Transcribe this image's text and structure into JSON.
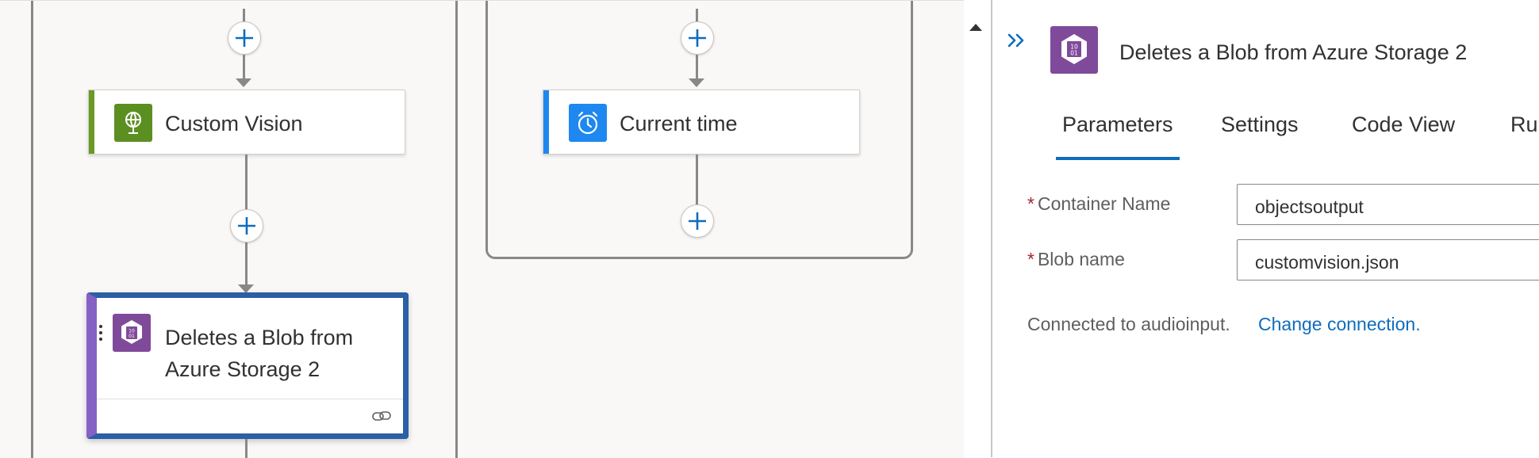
{
  "canvas": {
    "actions": {
      "custom_vision": {
        "title": "Custom Vision",
        "accent_color": "#6a9a24",
        "icon": "globe-icon",
        "icon_bg": "#5c8f22"
      },
      "current_time": {
        "title": "Current time",
        "accent_color": "#1e88f0",
        "icon": "alarm-clock-icon",
        "icon_bg": "#1e88f0"
      },
      "delete_blob": {
        "title": "Deletes a Blob from Azure Storage 2",
        "accent_color": "#8661c5",
        "icon": "blob-storage-icon",
        "icon_bg": "#804a9b",
        "footer_icon": "link-icon"
      }
    }
  },
  "panel": {
    "collapse_icon": "double-chevron-right-icon",
    "icon": "blob-storage-icon",
    "title": "Deletes a Blob from Azure Storage 2",
    "tabs": [
      {
        "label": "Parameters",
        "active": true
      },
      {
        "label": "Settings",
        "active": false
      },
      {
        "label": "Code View",
        "active": false
      },
      {
        "label": "Run",
        "active": false
      }
    ],
    "fields": [
      {
        "label": "Container Name",
        "required_marker": "*",
        "value": "objectsoutput"
      },
      {
        "label": "Blob name",
        "required_marker": "*",
        "value": "customvision.json"
      }
    ],
    "connection_text": "Connected to audioinput.",
    "change_connection_label": "Change connection."
  },
  "colors": {
    "accent": "#0f6cbd",
    "required": "#a4262c",
    "storage_purple": "#804a9b"
  }
}
